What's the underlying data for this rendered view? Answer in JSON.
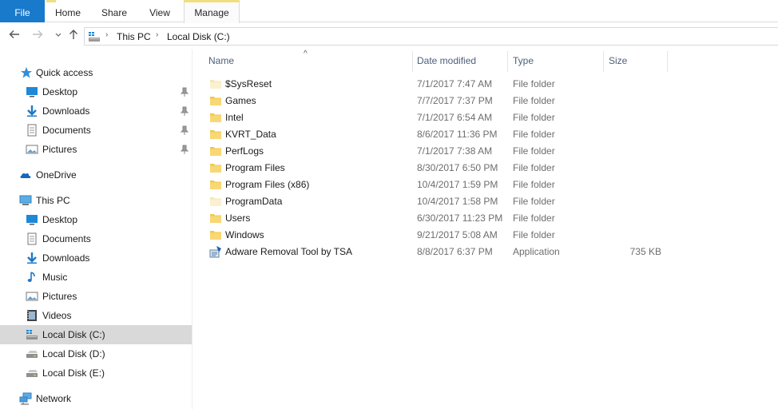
{
  "ribbon": {
    "tabs": [
      "File",
      "Home",
      "Share",
      "View",
      "Manage"
    ]
  },
  "colors": {
    "file_tab": "#1979ca",
    "manage_accent": "#f1de7f",
    "selected_row": "#d9d9d9",
    "header_text": "#4c607a",
    "folder": "#f8d775"
  },
  "nav": {
    "back_icon": "arrow-left-icon",
    "forward_icon": "arrow-right-icon",
    "recent_icon": "chevron-down-icon",
    "up_icon": "arrow-up-icon"
  },
  "address": {
    "crumbs": [
      "This PC",
      "Local Disk (C:)"
    ]
  },
  "sidebar": {
    "items": [
      {
        "label": "Quick access",
        "icon": "star-icon"
      },
      {
        "label": "Desktop",
        "icon": "desktop-icon"
      },
      {
        "label": "Downloads",
        "icon": "download-icon"
      },
      {
        "label": "Documents",
        "icon": "document-icon"
      },
      {
        "label": "Pictures",
        "icon": "pictures-icon"
      },
      {
        "label": "OneDrive",
        "icon": "cloud-icon"
      },
      {
        "label": "This PC",
        "icon": "computer-icon"
      },
      {
        "label": "Desktop",
        "icon": "desktop-icon"
      },
      {
        "label": "Documents",
        "icon": "document-icon"
      },
      {
        "label": "Downloads",
        "icon": "download-icon"
      },
      {
        "label": "Music",
        "icon": "music-icon"
      },
      {
        "label": "Pictures",
        "icon": "pictures-icon"
      },
      {
        "label": "Videos",
        "icon": "video-icon"
      },
      {
        "label": "Local Disk (C:)",
        "icon": "drive-c-icon"
      },
      {
        "label": "Local Disk (D:)",
        "icon": "drive-icon"
      },
      {
        "label": "Local Disk (E:)",
        "icon": "drive-icon"
      },
      {
        "label": "Network",
        "icon": "network-icon"
      }
    ]
  },
  "columns": {
    "name": "Name",
    "date": "Date modified",
    "type": "Type",
    "size": "Size"
  },
  "files": [
    {
      "name": "$SysReset",
      "date": "7/1/2017 7:47 AM",
      "type": "File folder",
      "size": "",
      "icon": "folder-light-icon"
    },
    {
      "name": "Games",
      "date": "7/7/2017 7:37 PM",
      "type": "File folder",
      "size": "",
      "icon": "folder-icon"
    },
    {
      "name": "Intel",
      "date": "7/1/2017 6:54 AM",
      "type": "File folder",
      "size": "",
      "icon": "folder-icon"
    },
    {
      "name": "KVRT_Data",
      "date": "8/6/2017 11:36 PM",
      "type": "File folder",
      "size": "",
      "icon": "folder-icon"
    },
    {
      "name": "PerfLogs",
      "date": "7/1/2017 7:38 AM",
      "type": "File folder",
      "size": "",
      "icon": "folder-icon"
    },
    {
      "name": "Program Files",
      "date": "8/30/2017 6:50 PM",
      "type": "File folder",
      "size": "",
      "icon": "folder-icon"
    },
    {
      "name": "Program Files (x86)",
      "date": "10/4/2017 1:59 PM",
      "type": "File folder",
      "size": "",
      "icon": "folder-icon"
    },
    {
      "name": "ProgramData",
      "date": "10/4/2017 1:58 PM",
      "type": "File folder",
      "size": "",
      "icon": "folder-light-icon"
    },
    {
      "name": "Users",
      "date": "6/30/2017 11:23 PM",
      "type": "File folder",
      "size": "",
      "icon": "folder-icon"
    },
    {
      "name": "Windows",
      "date": "9/21/2017 5:08 AM",
      "type": "File folder",
      "size": "",
      "icon": "folder-icon"
    },
    {
      "name": "Adware Removal Tool by TSA",
      "date": "8/8/2017 6:37 PM",
      "type": "Application",
      "size": "735 KB",
      "icon": "application-icon"
    }
  ]
}
